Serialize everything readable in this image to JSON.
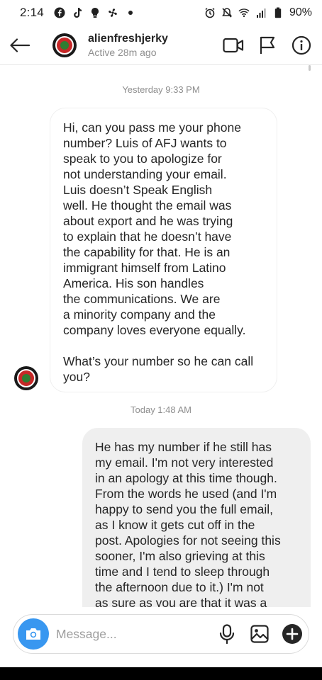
{
  "status_bar": {
    "time": "2:14",
    "battery": "90%",
    "left_icons": [
      "facebook-icon",
      "tiktok-icon",
      "lightbulb-icon",
      "fan-icon",
      "dot-icon"
    ],
    "right_icons": [
      "alarm-icon",
      "mute-icon",
      "wifi-icon",
      "signal-icon",
      "battery-icon"
    ]
  },
  "header": {
    "username": "alienfreshjerky",
    "status": "Active 28m ago",
    "actions": [
      "video-call-icon",
      "flag-icon",
      "info-icon"
    ]
  },
  "messages": [
    {
      "timestamp": "Yesterday 9:33 PM",
      "direction": "incoming",
      "text": "Hi, can you pass me your phone\nnumber? Luis of AFJ wants to\nspeak to you to apologize for\nnot understanding your email.\nLuis doesn’t Speak English\nwell. He thought the email was\nabout export and he was trying\nto explain that he doesn’t have\nthe capability for that. He is an\nimmigrant himself from Latino\nAmerica. His son handles\nthe communications. We are\na minority company and the\ncompany loves everyone equally.\n\nWhat’s your number so he can call\nyou?"
    },
    {
      "timestamp": "Today 1:48 AM",
      "direction": "outgoing",
      "text": "He has my number if he still has\nmy email. I'm not very interested\nin an apology at this time though.\nFrom the words he used (and I'm\nhappy to send you the full email,\nas I know it gets cut off in the\npost. Apologies for not seeing this\nsooner, I'm also grieving at this\ntime and I tend to sleep through\nthe afternoon due to it.) I'm not\nas sure as you are that it was a"
    }
  ],
  "composer": {
    "placeholder": "Message...",
    "value": "",
    "actions": [
      "microphone-icon",
      "gallery-icon",
      "add-icon"
    ]
  },
  "colors": {
    "accent": "#3897f0",
    "outgoing_bubble": "#efefef",
    "muted_text": "#8e8e8e"
  }
}
